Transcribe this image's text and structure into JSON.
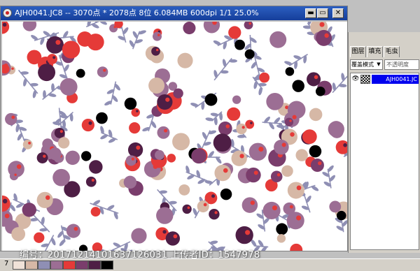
{
  "document": {
    "title": "AJH0041.JC8 -- 3070点 * 2078点 8位    6.084MB  600dpi  1/1    25.0%",
    "buttons": {
      "minimize": "▬",
      "maximize": "▭",
      "close": "✕"
    }
  },
  "watermark": "编号：20171214101637126031 上传者ID：1547978",
  "panel": {
    "tabs": [
      "图层",
      "填充",
      "毛虫"
    ],
    "blend_mode": "覆盖模式",
    "opacity_label": "不透明度",
    "layer_name": "AJH0041.JC"
  },
  "status": {
    "page": "7"
  },
  "palette": [
    "#f0e2d8",
    "#d6b8a6",
    "#8f8fb4",
    "#9c6e94",
    "#e53a38",
    "#7a3d6c",
    "#4e1e45",
    "#000000"
  ],
  "colors": {
    "plum": "#9c6e94",
    "dark_plum": "#4e1e45",
    "mid_purple": "#7a3d6c",
    "red": "#e53a38",
    "tan": "#d6b8a6",
    "leaf": "#8f8fb4",
    "black": "#000000",
    "titlebar": "#1f4fae",
    "selection": "#0000ee"
  }
}
